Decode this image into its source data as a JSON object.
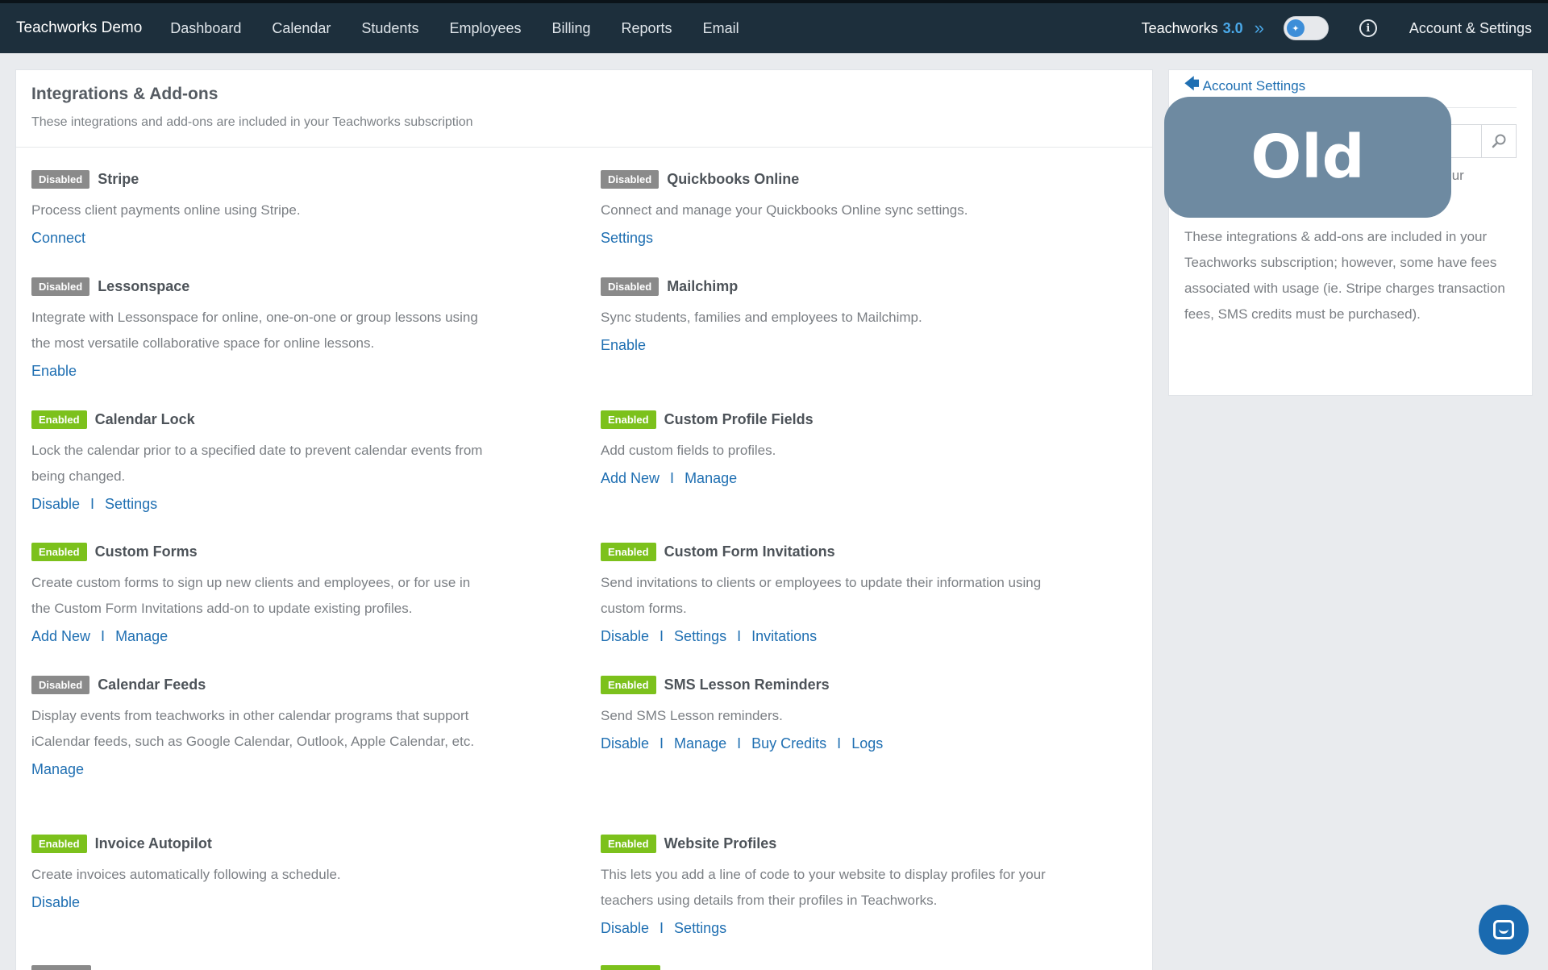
{
  "nav": {
    "brand": "Teachworks Demo",
    "items": [
      "Dashboard",
      "Calendar",
      "Students",
      "Employees",
      "Billing",
      "Reports",
      "Email"
    ],
    "version_label": "Teachworks",
    "version_number": "3.0",
    "account": "Account & Settings"
  },
  "main": {
    "title": "Integrations & Add-ons",
    "subtitle": "These integrations and add-ons are included in your Teachworks subscription",
    "addons": [
      {
        "status": "Disabled",
        "name": "Stripe",
        "desc": "Process client payments online using Stripe.",
        "links": [
          "Connect"
        ]
      },
      {
        "status": "Disabled",
        "name": "Quickbooks Online",
        "desc": "Connect and manage your Quickbooks Online sync settings.",
        "links": [
          "Settings"
        ]
      },
      {
        "status": "Disabled",
        "name": "Lessonspace",
        "desc": "Integrate with Lessonspace for online, one-on-one or group lessons using the most versatile collaborative space for online lessons.",
        "links": [
          "Enable"
        ]
      },
      {
        "status": "Disabled",
        "name": "Mailchimp",
        "desc": "Sync students, families and employees to Mailchimp.",
        "links": [
          "Enable"
        ]
      },
      {
        "status": "Enabled",
        "name": "Calendar Lock",
        "desc": "Lock the calendar prior to a specified date to prevent calendar events from being changed.",
        "links": [
          "Disable",
          "Settings"
        ]
      },
      {
        "status": "Enabled",
        "name": "Custom Profile Fields",
        "desc": "Add custom fields to profiles.",
        "links": [
          "Add New",
          "Manage"
        ]
      },
      {
        "status": "Enabled",
        "name": "Custom Forms",
        "desc": "Create custom forms to sign up new clients and employees, or for use in the Custom Form Invitations add-on to update existing profiles.",
        "links": [
          "Add New",
          "Manage"
        ]
      },
      {
        "status": "Enabled",
        "name": "Custom Form Invitations",
        "desc": "Send invitations to clients or employees to update their information using custom forms.",
        "links": [
          "Disable",
          "Settings",
          "Invitations"
        ]
      },
      {
        "status": "Disabled",
        "name": "Calendar Feeds",
        "desc": "Display events from teachworks in other calendar programs that support iCalendar feeds, such as Google Calendar, Outlook, Apple Calendar, etc.",
        "links": [
          "Manage"
        ]
      },
      {
        "status": "Enabled",
        "name": "SMS Lesson Reminders",
        "desc": "Send SMS Lesson reminders.",
        "links": [
          "Disable",
          "Manage",
          "Buy Credits",
          "Logs"
        ]
      },
      {
        "status": "Enabled",
        "name": "Invoice Autopilot",
        "desc": "Create invoices automatically following a schedule.",
        "links": [
          "Disable"
        ]
      },
      {
        "status": "Enabled",
        "name": "Website Profiles",
        "desc": "This lets you add a line of code to your website to display profiles for your teachers using details from their profiles in Teachworks.",
        "links": [
          "Disable",
          "Settings"
        ]
      }
    ]
  },
  "sidebar": {
    "back_link": "Account Settings",
    "para1_visible": "on this page to extend the functionality of your Teachworks account.",
    "para2": "These integrations & add-ons are included in your Teachworks subscription; however, some have fees associated with usage (ie. Stripe charges transaction fees, SMS credits must be purchased)."
  },
  "overlay": {
    "label": "Old"
  },
  "colors": {
    "navbar": "#1d2f3c",
    "enabled": "#7cc11c",
    "disabled": "#8a8a8a",
    "link": "#1f6fb2",
    "accent": "#4aa8e8"
  },
  "icons": [
    "chevron-double-right-icon",
    "info-icon",
    "search-icon",
    "back-arrow-icon",
    "chat-icon"
  ]
}
